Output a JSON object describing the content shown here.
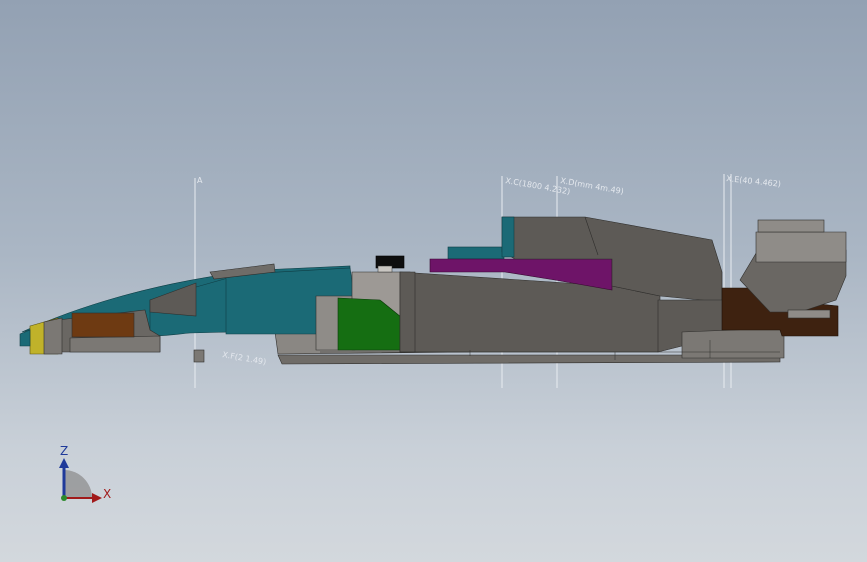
{
  "viewport": {
    "background_top": "#93a1b3",
    "background_bottom": "#d3d8dd"
  },
  "reference_labels": {
    "plane_a": "A",
    "plane_b": "X.C(1800 4.232)",
    "plane_c": "X.D(mm 4m.49)",
    "plane_d": "X.E(40 4.462)",
    "plane_e": "X.F(2 1.49)"
  },
  "triad": {
    "z_label": "Z",
    "x_label": "X",
    "z_color": "#1f3a9a",
    "x_color": "#a11a1a"
  },
  "model": {
    "body_teal": "#1b6a76",
    "body_gray": "#5d5a56",
    "accent_purple": "#6e1468",
    "accent_green": "#156e12",
    "accent_brown": "#6e3a12",
    "accent_yellow": "#c0b22a"
  }
}
